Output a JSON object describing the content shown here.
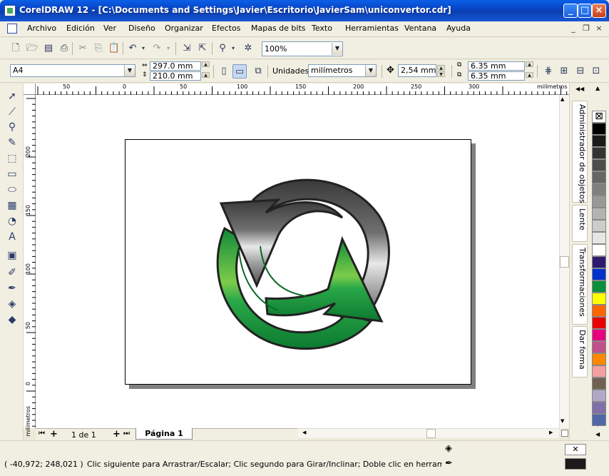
{
  "window": {
    "title": "CorelDRAW 12 - [C:\\Documents and Settings\\Javier\\Escritorio\\JavierSam\\uniconvertor.cdr]"
  },
  "menu": [
    "Archivo",
    "Edición",
    "Ver",
    "Diseño",
    "Organizar",
    "Efectos",
    "Mapas de bits",
    "Texto",
    "Herramientas",
    "Ventana",
    "Ayuda"
  ],
  "standard_toolbar": {
    "zoom_value": "100%"
  },
  "property_bar": {
    "page_size": "A4",
    "width": "297.0 mm",
    "height": "210.0 mm",
    "units_label": "Unidades:",
    "units_value": "milímetros",
    "nudge": "2,54 mm",
    "dup_x": "6.35 mm",
    "dup_y": "6.35 mm"
  },
  "rulers": {
    "unit": "milímetros",
    "h_labels": [
      "50",
      "0",
      "50",
      "100",
      "150",
      "200",
      "250",
      "300"
    ],
    "v_labels": [
      "200",
      "150",
      "100",
      "50",
      "0"
    ]
  },
  "page_nav": {
    "page_count": "1 de 1",
    "page_tab": "Página 1"
  },
  "dockers": [
    "Administrador de objetos",
    "Lente",
    "Transformaciones",
    "Dar forma"
  ],
  "palette": [
    "#000000",
    "#1a1a1a",
    "#333333",
    "#4d4d4d",
    "#666666",
    "#808080",
    "#999999",
    "#b3b3b3",
    "#cccccc",
    "#e6e6e6",
    "#ffffff",
    "#2e1a6e",
    "#0033cc",
    "#0a8f3a",
    "#ffff00",
    "#ff6600",
    "#e60000",
    "#e6007e",
    "#c0508a",
    "#ff8800",
    "#f4a0a0",
    "#706050",
    "#b0a8c8",
    "#8070a8",
    "#5068a8"
  ],
  "status": {
    "coords": "( -40,972; 248,021 )",
    "message": "Clic siguiente para Arrastrar/Escalar; Clic segundo para Girar/Inclinar; Doble clic en herramienta selecc..."
  }
}
